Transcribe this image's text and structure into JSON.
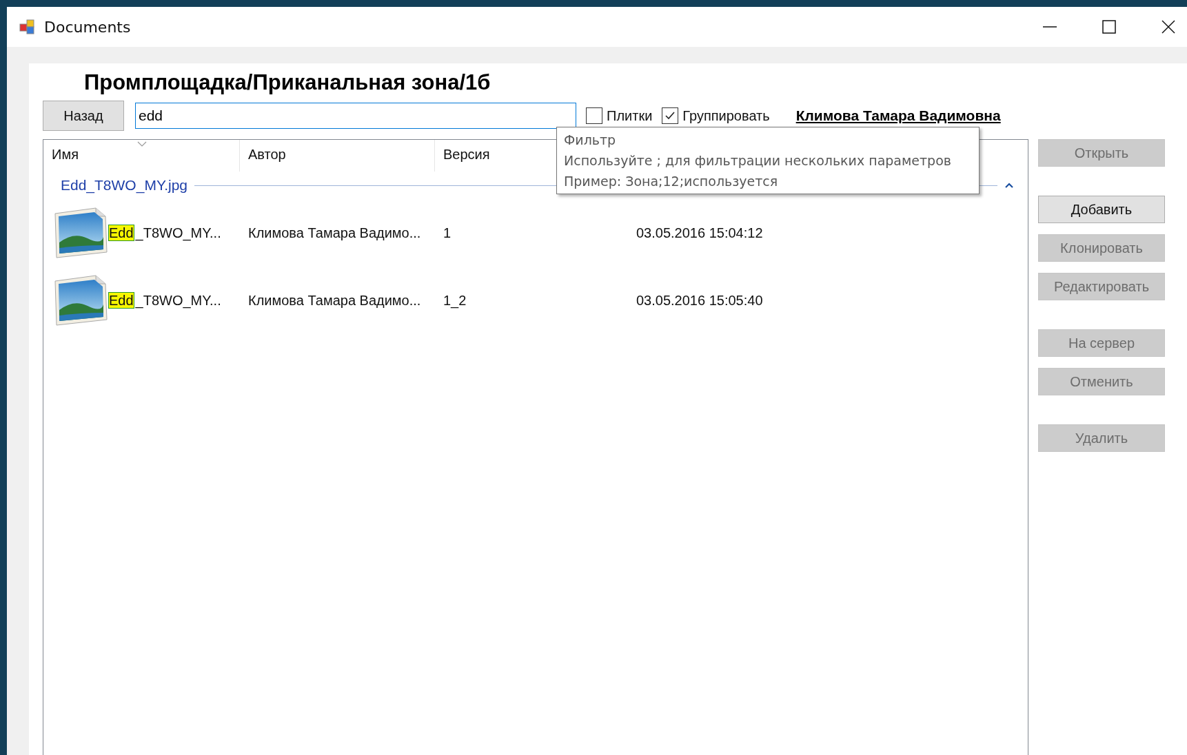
{
  "window": {
    "title": "Documents"
  },
  "path_heading": "Промплощадка/Приканальная зона/1б",
  "back_button": "Назад",
  "filter": {
    "value": "edd"
  },
  "options": [
    {
      "label": "Плитки",
      "checked": false
    },
    {
      "label": "Группировать",
      "checked": true
    }
  ],
  "user_link": "Климова Тамара Вадимовна",
  "tooltip": {
    "title": "Фильтр",
    "lines": [
      "Используйте ; для фильтрации нескольких параметров",
      "Пример: Зона;12;используется"
    ]
  },
  "table": {
    "columns": [
      {
        "label": "Имя",
        "sorted": true
      },
      {
        "label": "Автор",
        "sorted": false
      },
      {
        "label": "Версия",
        "sorted": false
      }
    ],
    "groups": [
      {
        "title": "Edd_T8WO_MY.jpg",
        "expanded": true,
        "rows": [
          {
            "name_match": "Edd",
            "name_rest": "_T8WO_MY...",
            "author": "Климова Тамара Вадимо...",
            "version": "1",
            "date": "03.05.2016 15:04:12"
          },
          {
            "name_match": "Edd",
            "name_rest": "_T8WO_MY...",
            "author": "Климова Тамара Вадимо...",
            "version": "1_2",
            "date": "03.05.2016 15:05:40"
          }
        ]
      }
    ]
  },
  "action_groups": [
    [
      {
        "label": "Открыть",
        "disabled": true
      }
    ],
    [
      {
        "label": "Добавить",
        "disabled": false
      },
      {
        "label": "Клонировать",
        "disabled": true
      },
      {
        "label": "Редактировать",
        "disabled": true
      }
    ],
    [
      {
        "label": "На сервер",
        "disabled": true
      },
      {
        "label": "Отменить",
        "disabled": true
      }
    ],
    [
      {
        "label": "Удалить",
        "disabled": true
      }
    ]
  ]
}
